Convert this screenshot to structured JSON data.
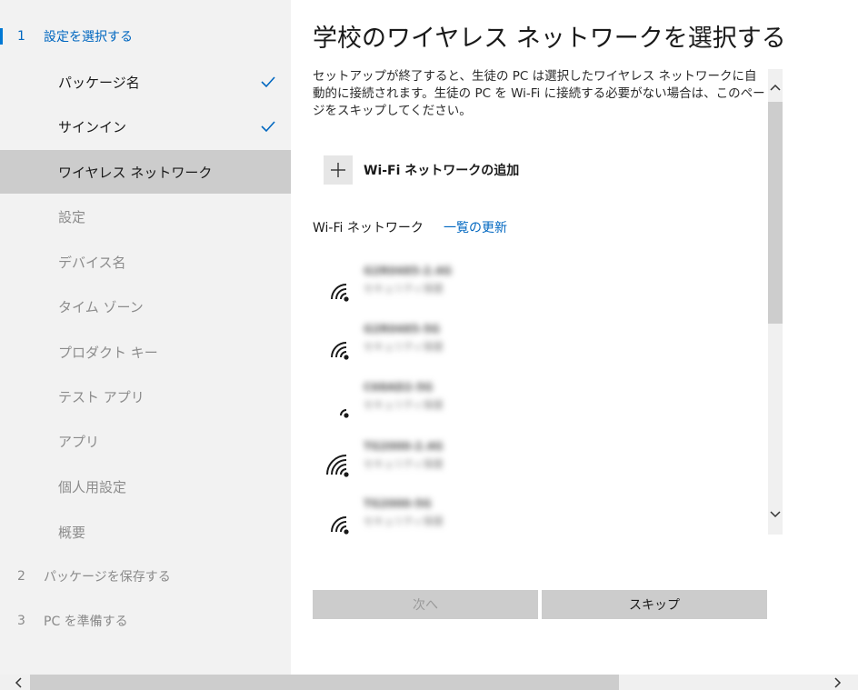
{
  "sidebar": {
    "steps": [
      {
        "num": "1",
        "label": "設定を選択する"
      },
      {
        "num": "2",
        "label": "パッケージを保存する"
      },
      {
        "num": "3",
        "label": "PC を準備する"
      }
    ],
    "substeps": [
      {
        "label": "パッケージ名",
        "state": "done"
      },
      {
        "label": "サインイン",
        "state": "done"
      },
      {
        "label": "ワイヤレス ネットワーク",
        "state": "current"
      },
      {
        "label": "設定",
        "state": "pending"
      },
      {
        "label": "デバイス名",
        "state": "pending"
      },
      {
        "label": "タイム ゾーン",
        "state": "pending"
      },
      {
        "label": "プロダクト キー",
        "state": "pending"
      },
      {
        "label": "テスト アプリ",
        "state": "pending"
      },
      {
        "label": "アプリ",
        "state": "pending"
      },
      {
        "label": "個人用設定",
        "state": "pending"
      },
      {
        "label": "概要",
        "state": "pending"
      }
    ]
  },
  "main": {
    "title": "学校のワイヤレス ネットワークを選択する",
    "description": "セットアップが終了すると、生徒の PC は選択したワイヤレス ネットワークに自動的に接続されます。生徒の PC を Wi-Fi に接続する必要がない場合は、このページをスキップしてください。",
    "add_network_label": "Wi-Fi ネットワークの追加",
    "networks_heading": "Wi-Fi ネットワーク",
    "refresh_label": "一覧の更新",
    "networks": [
      {
        "ssid": "G2R0485-2.4G",
        "status": "セキュリティ保護",
        "signal": 3
      },
      {
        "ssid": "G2R0485-5G",
        "status": "セキュリティ保護",
        "signal": 3
      },
      {
        "ssid": "C68AD2-5G",
        "status": "セキュリティ保護",
        "signal": 1
      },
      {
        "ssid": "TG2000-2.4G",
        "status": "セキュリティ保護",
        "signal": 4
      },
      {
        "ssid": "TG2000-5G",
        "status": "セキュリティ保護",
        "signal": 3
      }
    ],
    "next_label": "次へ",
    "skip_label": "スキップ"
  },
  "colors": {
    "accent": "#0067c0",
    "sidebar_bg": "#f2f2f2",
    "selected_bg": "#cccccc",
    "button_bg": "#cccccc"
  }
}
